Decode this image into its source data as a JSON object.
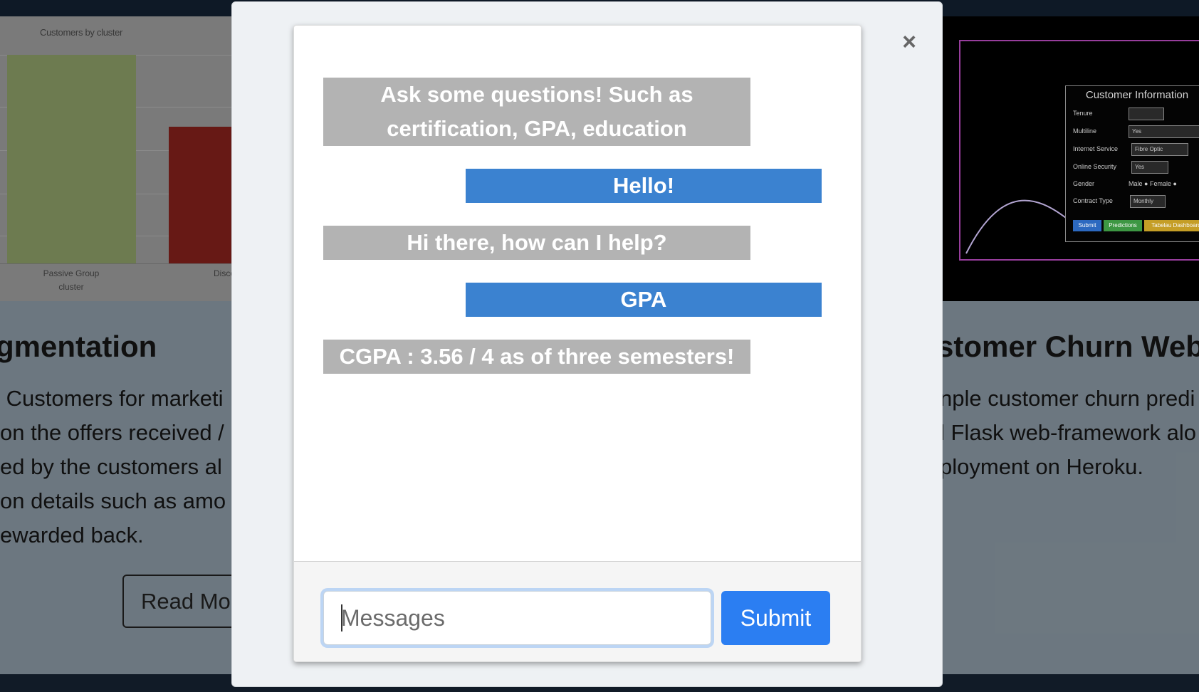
{
  "background": {
    "left_card": {
      "chart_title": "Customers by cluster",
      "category_1": "Passive Group cluster",
      "category_2": "Disco",
      "title": "gmentation",
      "text": " Customers for marketi\non the offers received /\ned by the customers al\non details such as amo\newarded back.",
      "read_more": "Read Mo"
    },
    "right_card": {
      "panel_title": "Customer Information",
      "rows": [
        "Tenure",
        "Multiline",
        "Internet Service",
        "Online Security",
        "Gender",
        "Contract Type"
      ],
      "values": [
        "",
        "Yes",
        "Fibre Optic",
        "Yes",
        "Male ● Female ●",
        "Monthly"
      ],
      "buttons": [
        "Submit",
        "Predictions",
        "Tabelau Dashboard"
      ],
      "title": "stomer Churn Web A",
      "text": "nple customer churn predi\nl Flask web-framework alo\nployment on Heroku."
    }
  },
  "modal": {
    "close": "×",
    "messages": [
      {
        "from": "bot",
        "text": "Ask some questions! Such as certification, GPA, education"
      },
      {
        "from": "user",
        "text": "Hello!"
      },
      {
        "from": "bot",
        "text": "Hi there, how can I help?"
      },
      {
        "from": "user",
        "text": "GPA"
      },
      {
        "from": "bot",
        "text": "CGPA : 3.56 / 4 as of three semesters!"
      }
    ],
    "input_placeholder": "Messages",
    "submit_label": "Submit"
  },
  "colors": {
    "bot_bubble": "#b3b3b3",
    "user_bubble": "#3b82d0",
    "submit": "#2b7ef2"
  }
}
